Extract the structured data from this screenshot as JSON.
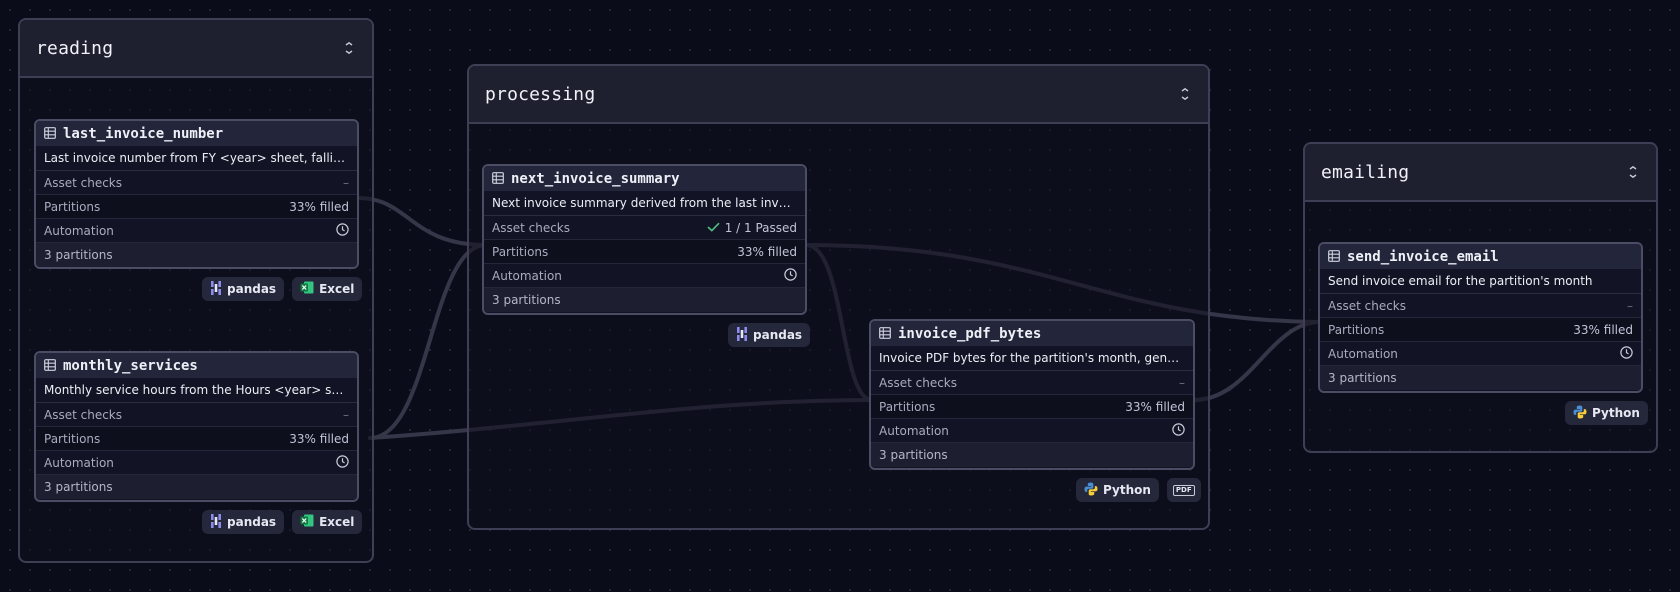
{
  "groups": [
    {
      "id": "reading",
      "title": "reading"
    },
    {
      "id": "processing",
      "title": "processing"
    },
    {
      "id": "emailing",
      "title": "emailing"
    }
  ],
  "assets": {
    "last_invoice_number": {
      "name": "last_invoice_number",
      "description": "Last invoice number from FY <year> sheet, falling back to the previous year",
      "asset_checks_label": "Asset checks",
      "asset_checks_value": "–",
      "partitions_label": "Partitions",
      "partitions_value": "33% filled",
      "automation_label": "Automation",
      "partitions_count": "3 partitions",
      "tags": [
        "pandas",
        "Excel"
      ]
    },
    "monthly_services": {
      "name": "monthly_services",
      "description": "Monthly service hours from the Hours <year> sheet of the workbook",
      "asset_checks_label": "Asset checks",
      "asset_checks_value": "–",
      "partitions_label": "Partitions",
      "partitions_value": "33% filled",
      "automation_label": "Automation",
      "partitions_count": "3 partitions",
      "tags": [
        "pandas",
        "Excel"
      ]
    },
    "next_invoice_summary": {
      "name": "next_invoice_summary",
      "description": "Next invoice summary derived from the last invoice number and services",
      "asset_checks_label": "Asset checks",
      "asset_checks_value": "1 / 1 Passed",
      "partitions_label": "Partitions",
      "partitions_value": "33% filled",
      "automation_label": "Automation",
      "partitions_count": "3 partitions",
      "tags": [
        "pandas"
      ]
    },
    "invoice_pdf_bytes": {
      "name": "invoice_pdf_bytes",
      "description": "Invoice PDF bytes for the partition's month, generated from the template",
      "asset_checks_label": "Asset checks",
      "asset_checks_value": "–",
      "partitions_label": "Partitions",
      "partitions_value": "33% filled",
      "automation_label": "Automation",
      "partitions_count": "3 partitions",
      "tags": [
        "Python"
      ],
      "pdf_tag": "PDF"
    },
    "send_invoice_email": {
      "name": "send_invoice_email",
      "description": "Send invoice email for the partition's month",
      "asset_checks_label": "Asset checks",
      "asset_checks_value": "–",
      "partitions_label": "Partitions",
      "partitions_value": "33% filled",
      "automation_label": "Automation",
      "partitions_count": "3 partitions",
      "tags": [
        "Python"
      ]
    }
  },
  "icons": {
    "asset": "table-icon",
    "automation": "clock-icon",
    "collapse": "collapse-icon",
    "pandas": "pandas-icon",
    "excel": "excel-icon",
    "python": "python-icon",
    "pdf": "pdf-icon",
    "check": "checkmark-icon"
  },
  "colors": {
    "background": "#0b0c1a",
    "group_border": "#3d4055",
    "node_border": "#4a4d63",
    "edge": "#3a3c52",
    "check": "#4fbf80",
    "excel": "#1e7e45"
  }
}
